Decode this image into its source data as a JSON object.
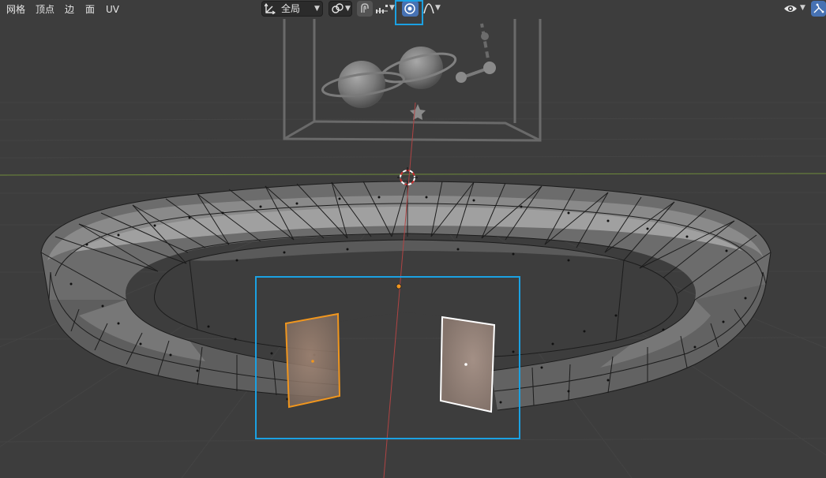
{
  "menubar": {
    "items": [
      "网格",
      "顶点",
      "边",
      "面",
      "UV"
    ]
  },
  "toolbar": {
    "transform_orientation": "全局"
  },
  "colors": {
    "background": "#3d3d3d",
    "grid": "#454545",
    "selection_orange": "#f0961e",
    "active_white": "#ffffff",
    "highlight_blue": "#1ba1e2",
    "axis_x": "#b04444",
    "axis_y": "#6e8a3a"
  },
  "icons": [
    "transform-pivot-icon",
    "snap-icon",
    "proportional-editing-icon",
    "snap-increment-icon",
    "proportional-circle-icon",
    "falloff-curve-icon",
    "visibility-eye-icon",
    "gizmo-icon",
    "3d-cursor-icon"
  ]
}
